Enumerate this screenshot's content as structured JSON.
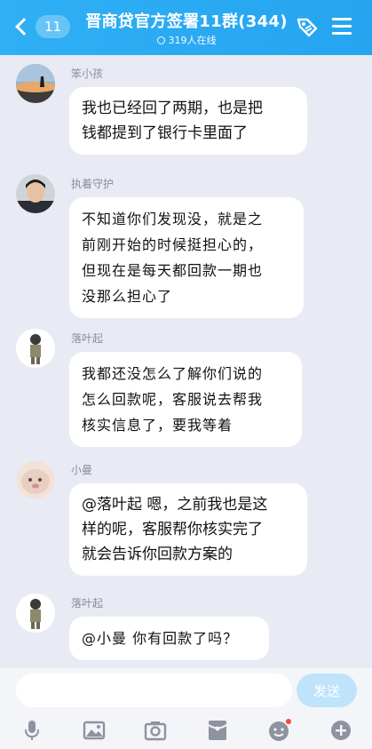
{
  "header": {
    "back_count": "11",
    "title": "晋商贷官方签署11群(344)",
    "online": "319人在线"
  },
  "messages": [
    {
      "sender": "笨小孩",
      "lines": [
        "我也已经回了两期，也是把",
        "钱都提到了银行卡里面了"
      ]
    },
    {
      "sender": "执着守护",
      "lines": [
        "不知道你们发现没，就是之",
        "前刚开始的时候挺担心的，",
        "但现在是每天都回款一期也",
        "没那么担心了"
      ]
    },
    {
      "sender": "落叶起",
      "lines": [
        "我都还没怎么了解你们说的",
        "怎么回款呢，客服说去帮我",
        "核实信息了，要我等着"
      ]
    },
    {
      "sender": "小曼",
      "lines": [
        "@落叶起 嗯，之前我也是这",
        "样的呢，客服帮你核实完了",
        "就会告诉你回款方案的"
      ]
    },
    {
      "sender": "落叶起",
      "lines": [
        "@小曼 你有回款了吗？"
      ]
    }
  ],
  "composer": {
    "send_label": "发送",
    "icons": [
      "microphone-icon",
      "image-icon",
      "camera-icon",
      "red-packet-icon",
      "emoji-icon",
      "plus-icon"
    ]
  },
  "colors": {
    "header": "#2fb0f5",
    "background": "#e9ebf4",
    "send_disabled": "#bfe3fb"
  }
}
